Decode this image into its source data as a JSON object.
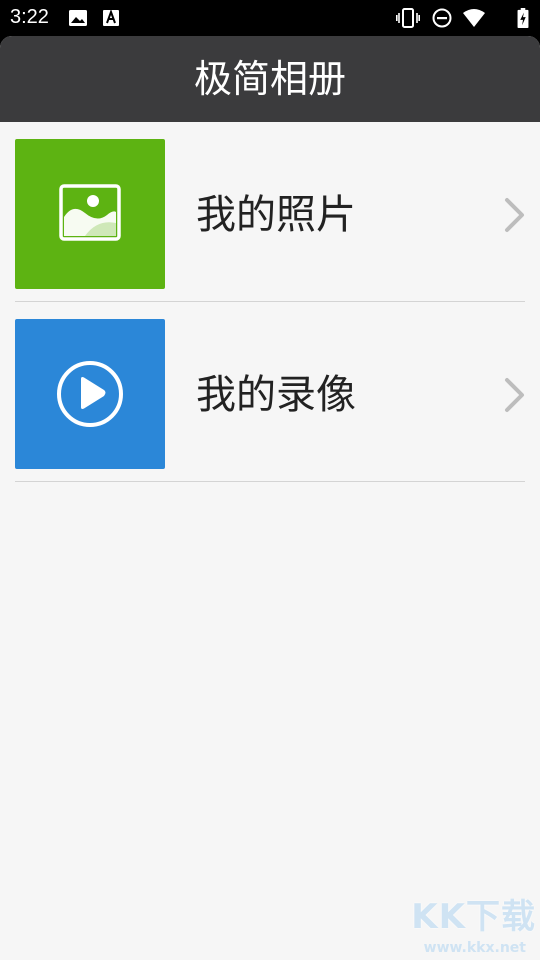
{
  "status_bar": {
    "time": "3:22",
    "left_icons": [
      "image-icon",
      "font-a-icon"
    ],
    "right_icons": [
      "vibrate-icon",
      "do-not-disturb-icon",
      "wifi-icon",
      "battery-charging-icon"
    ]
  },
  "app": {
    "title": "极简相册",
    "title_bar_color": "#3b3b3d"
  },
  "menu": {
    "items": [
      {
        "label": "我的照片",
        "icon": "photo-icon",
        "tile_color": "#5db312"
      },
      {
        "label": "我的录像",
        "icon": "play-circle-icon",
        "tile_color": "#2b87d8"
      }
    ]
  },
  "watermark": {
    "text": "KK下载",
    "url": "www.kkx.net"
  }
}
